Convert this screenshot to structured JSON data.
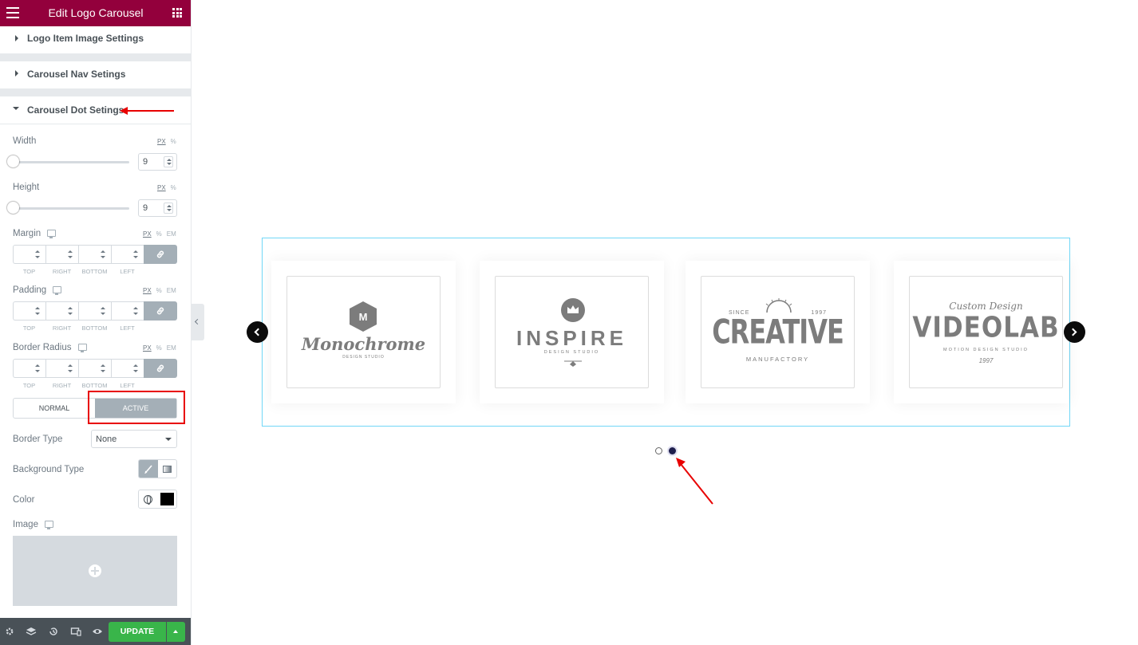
{
  "header": {
    "title": "Edit Logo Carousel"
  },
  "sections": [
    {
      "label": "Logo Item Image Settings",
      "expanded": false
    },
    {
      "label": "Carousel Nav Setings",
      "expanded": false
    },
    {
      "label": "Carousel Dot Setings",
      "expanded": true
    }
  ],
  "controls": {
    "width": {
      "label": "Width",
      "value": "9",
      "units": [
        "PX",
        "%"
      ]
    },
    "height": {
      "label": "Height",
      "value": "9",
      "units": [
        "PX",
        "%"
      ]
    },
    "margin": {
      "label": "Margin",
      "units": [
        "PX",
        "%",
        "EM"
      ]
    },
    "padding": {
      "label": "Padding",
      "units": [
        "PX",
        "%",
        "EM"
      ]
    },
    "border_radius": {
      "label": "Border Radius",
      "units": [
        "PX",
        "%",
        "EM"
      ]
    },
    "dimension_labels": [
      "TOP",
      "RIGHT",
      "BOTTOM",
      "LEFT"
    ],
    "state_tabs": {
      "normal": "NORMAL",
      "active": "ACTIVE",
      "selected": "active"
    },
    "border_type": {
      "label": "Border Type",
      "value": "None"
    },
    "background_type": {
      "label": "Background Type",
      "selected": "classic"
    },
    "color": {
      "label": "Color",
      "value": "#000000"
    },
    "image": {
      "label": "Image"
    }
  },
  "footer": {
    "update_label": "UPDATE"
  },
  "preview": {
    "logos": [
      {
        "name": "Monochrome",
        "tagline": "DESIGN STUDIO",
        "badge": "M"
      },
      {
        "name": "INSPIRE",
        "tagline": "DESIGN STUDIO"
      },
      {
        "name": "CREATIVE",
        "top_left": "SINCE",
        "top_right": "1997",
        "tagline": "MANUFACTORY"
      },
      {
        "name": "VIDEOLAB",
        "script": "Custom Design",
        "tagline": "MOTION DESIGN STUDIO",
        "year": "1997"
      }
    ],
    "dots": {
      "count": 2,
      "active_index": 2
    }
  },
  "colors": {
    "header": "#93003c",
    "update": "#39b54a",
    "highlight": "#e80000",
    "frame": "#71d7f7"
  }
}
